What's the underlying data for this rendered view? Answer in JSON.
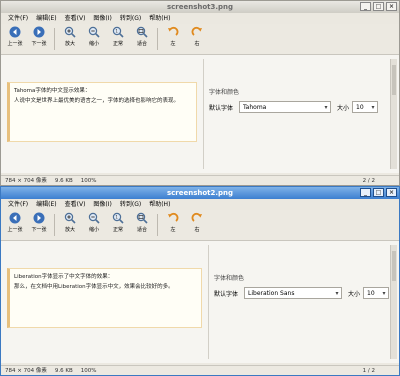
{
  "windows": [
    {
      "title": "screenshot3.png",
      "menu": [
        "文件(F)",
        "编辑(E)",
        "查看(V)",
        "图像(I)",
        "转到(G)",
        "帮助(H)"
      ],
      "toolbar": [
        {
          "label": "上一张",
          "icon": "prev-icon"
        },
        {
          "label": "下一张",
          "icon": "next-icon"
        },
        {
          "label": "放大",
          "icon": "zoom-in-icon"
        },
        {
          "label": "缩小",
          "icon": "zoom-out-icon"
        },
        {
          "label": "正常",
          "icon": "zoom-normal-icon"
        },
        {
          "label": "适合",
          "icon": "zoom-fit-icon"
        },
        {
          "label": "左",
          "icon": "rotate-left-icon"
        },
        {
          "label": "右",
          "icon": "rotate-right-icon"
        }
      ],
      "preview_lines": [
        "Tahoma字体的中文显示效果：",
        "人说中文是世界上最优美的语言之一，字体的选择也影响它的表现。"
      ],
      "font_section": "字体和颜色",
      "font_label": "默认字体",
      "font_value": "Tahoma",
      "size_label": "大小",
      "size_value": "10",
      "status": {
        "dims": "784 × 704 像素",
        "size": "9.6 KB",
        "zoom": "100%",
        "page": "2 / 2"
      }
    },
    {
      "title": "screenshot2.png",
      "menu": [
        "文件(F)",
        "编辑(E)",
        "查看(V)",
        "图像(I)",
        "转到(G)",
        "帮助(H)"
      ],
      "toolbar": [
        {
          "label": "上一张",
          "icon": "prev-icon"
        },
        {
          "label": "下一张",
          "icon": "next-icon"
        },
        {
          "label": "放大",
          "icon": "zoom-in-icon"
        },
        {
          "label": "缩小",
          "icon": "zoom-out-icon"
        },
        {
          "label": "正常",
          "icon": "zoom-normal-icon"
        },
        {
          "label": "适合",
          "icon": "zoom-fit-icon"
        },
        {
          "label": "左",
          "icon": "rotate-left-icon"
        },
        {
          "label": "右",
          "icon": "rotate-right-icon"
        }
      ],
      "preview_lines": [
        "Liberation字体显示了中文字体的效果：",
        "那么，在文档中用Liberation字体显示中文，效果会比较好的多。"
      ],
      "font_section": "字体和颜色",
      "font_label": "默认字体",
      "font_value": "Liberation Sans",
      "size_label": "大小",
      "size_value": "10",
      "status": {
        "dims": "784 × 704 像素",
        "size": "9.6 KB",
        "zoom": "100%",
        "page": "1 / 2"
      }
    }
  ],
  "colors": {
    "active_title": "#3d7fd0",
    "inactive_title": "#cfcdc5",
    "preview_border": "#e7c07e"
  }
}
